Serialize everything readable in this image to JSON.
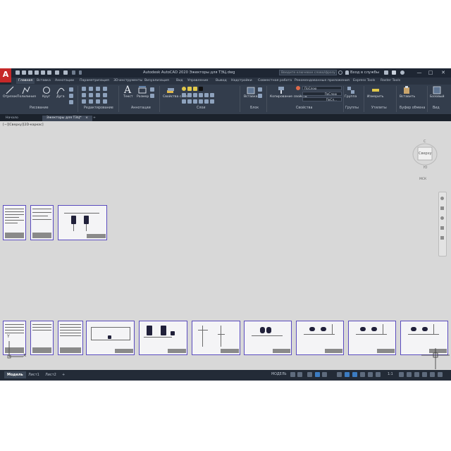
{
  "titlebar": {
    "app_letter": "A",
    "title": "Autodesk AutoCAD 2020   Эжекторы для ТЭЦ.dwg",
    "search_placeholder": "Введите ключевое слово/фразу",
    "signin": "Вход в службы",
    "minimize": "—",
    "maximize": "□",
    "close": "✕"
  },
  "ribbon_tabs": [
    "Главная",
    "Вставка",
    "Аннотации",
    "Параметризация",
    "3D-инструменты",
    "Визуализация",
    "Вид",
    "Управление",
    "Вывод",
    "Надстройки",
    "Совместная работа",
    "Рекомендованные приложения",
    "Express Tools",
    "Raster Tools"
  ],
  "ribbon": {
    "draw": {
      "line": "Отрезок",
      "polyline": "Полилиния",
      "circle": "Круг",
      "arc": "Дуга",
      "panel": "Рисование"
    },
    "modify": {
      "panel": "Редактирование"
    },
    "annotation": {
      "text": "Текст",
      "dimension": "Размер",
      "panel": "Аннотации"
    },
    "layers": {
      "layer_props": "Свойства слоя",
      "panel": "Слои"
    },
    "block": {
      "insert": "Вставка",
      "panel": "Блок"
    },
    "properties": {
      "match": "Копирование свойств",
      "bylayer1": "ПоСлою",
      "bylayer2": "ПоСлою",
      "bylayer3": "ПоСл...",
      "panel": "Свойства"
    },
    "groups": {
      "group": "Группа",
      "panel": "Группы"
    },
    "utilities": {
      "measure": "Измерить",
      "panel": "Утилиты"
    },
    "clipboard": {
      "paste": "Вставить",
      "panel": "Буфер обмена"
    },
    "view": {
      "base": "Базовый",
      "panel": "Вид"
    }
  },
  "doc_tabs": [
    {
      "label": "Начало"
    },
    {
      "label": "Эжекторы для ТЭЦ*",
      "close": "×"
    },
    {
      "label": "+"
    }
  ],
  "canvas": {
    "viewport_label": "[−][Сверху][2D-каркас]",
    "viewcube_face": "Сверху",
    "viewcube_north": "С",
    "viewcube_south": "Ю",
    "ucs_label": "МСК",
    "ucs_x": "X",
    "ucs_y": "Y"
  },
  "bottom": {
    "layout_tabs": [
      "Модель",
      "Лист1",
      "Лист2"
    ],
    "add_tab": "+",
    "model_label": "МОДЕЛЬ",
    "scale": "1:1"
  },
  "colors": {
    "accent": "#3c7cc2",
    "logo_red": "#c62828",
    "sheet_border": "#5a4bbf",
    "canvas_bg": "#d8d8d8",
    "ui_dark": "#1f2630"
  }
}
